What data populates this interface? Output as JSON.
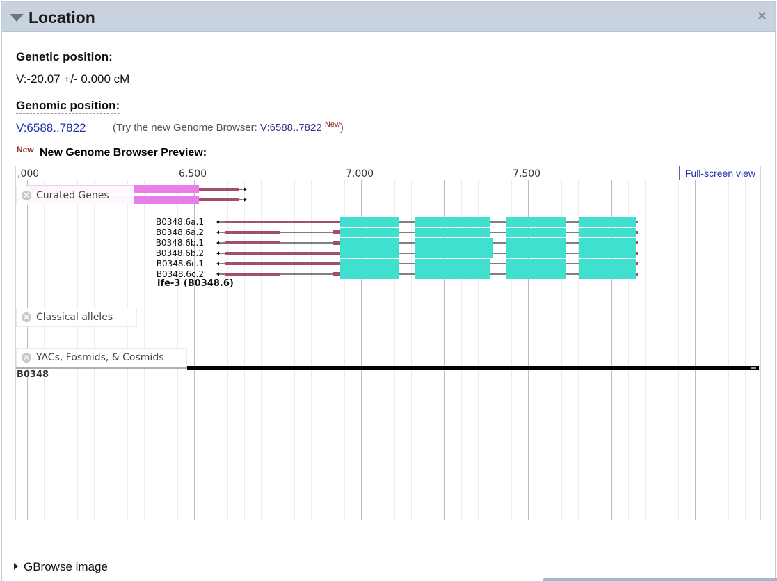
{
  "panel": {
    "title": "Location",
    "close_symbol": "×"
  },
  "genetic": {
    "label": "Genetic position:",
    "value": "V:-20.07 +/- 0.000 cM"
  },
  "genomic": {
    "label": "Genomic position:",
    "value": "V:6588..7822",
    "hint_prefix": "(Try the new Genome Browser: ",
    "hint_link": "V:6588..7822",
    "hint_new": "New",
    "hint_suffix": ")"
  },
  "preview": {
    "new_badge": "New",
    "title": "New Genome Browser Preview:"
  },
  "browser": {
    "ruler_labels": [
      ",000",
      "6,500",
      "7,000",
      "7,500"
    ],
    "fullscreen_label": "Full-screen view",
    "tracks": {
      "curated_genes": "Curated Genes",
      "classical_alleles": "Classical alleles",
      "yacs": "YACs, Fosmids, & Cosmids"
    },
    "close_symbol": "×",
    "transcripts": [
      "B0348.6a.1",
      "B0348.6a.2",
      "B0348.6b.1",
      "B0348.6b.2",
      "B0348.6c.1",
      "B0348.6c.2"
    ],
    "gene_label": "lfe-3 (B0348.6)",
    "clone_label": "B0348",
    "colors": {
      "utr": "#a05068",
      "exon": "#40e0d0",
      "upstream_gene": "#e87ee8",
      "upstream_gene_faded": "#f5c8f5",
      "clone": "#000000"
    }
  },
  "gbrowse": {
    "label": "GBrowse image"
  }
}
